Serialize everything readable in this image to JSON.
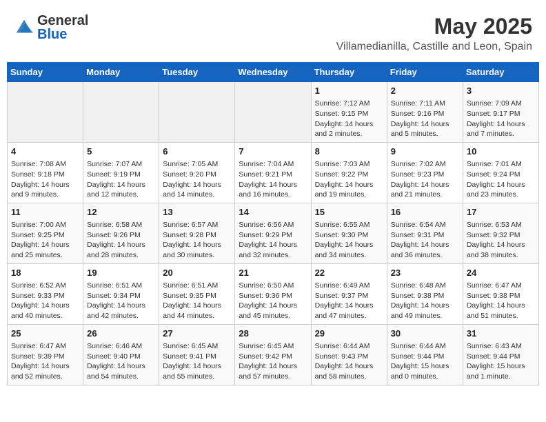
{
  "header": {
    "logo_general": "General",
    "logo_blue": "Blue",
    "month": "May 2025",
    "location": "Villamedianilla, Castille and Leon, Spain"
  },
  "days_of_week": [
    "Sunday",
    "Monday",
    "Tuesday",
    "Wednesday",
    "Thursday",
    "Friday",
    "Saturday"
  ],
  "weeks": [
    [
      {
        "day": "",
        "info": ""
      },
      {
        "day": "",
        "info": ""
      },
      {
        "day": "",
        "info": ""
      },
      {
        "day": "",
        "info": ""
      },
      {
        "day": "1",
        "info": "Sunrise: 7:12 AM\nSunset: 9:15 PM\nDaylight: 14 hours\nand 2 minutes."
      },
      {
        "day": "2",
        "info": "Sunrise: 7:11 AM\nSunset: 9:16 PM\nDaylight: 14 hours\nand 5 minutes."
      },
      {
        "day": "3",
        "info": "Sunrise: 7:09 AM\nSunset: 9:17 PM\nDaylight: 14 hours\nand 7 minutes."
      }
    ],
    [
      {
        "day": "4",
        "info": "Sunrise: 7:08 AM\nSunset: 9:18 PM\nDaylight: 14 hours\nand 9 minutes."
      },
      {
        "day": "5",
        "info": "Sunrise: 7:07 AM\nSunset: 9:19 PM\nDaylight: 14 hours\nand 12 minutes."
      },
      {
        "day": "6",
        "info": "Sunrise: 7:05 AM\nSunset: 9:20 PM\nDaylight: 14 hours\nand 14 minutes."
      },
      {
        "day": "7",
        "info": "Sunrise: 7:04 AM\nSunset: 9:21 PM\nDaylight: 14 hours\nand 16 minutes."
      },
      {
        "day": "8",
        "info": "Sunrise: 7:03 AM\nSunset: 9:22 PM\nDaylight: 14 hours\nand 19 minutes."
      },
      {
        "day": "9",
        "info": "Sunrise: 7:02 AM\nSunset: 9:23 PM\nDaylight: 14 hours\nand 21 minutes."
      },
      {
        "day": "10",
        "info": "Sunrise: 7:01 AM\nSunset: 9:24 PM\nDaylight: 14 hours\nand 23 minutes."
      }
    ],
    [
      {
        "day": "11",
        "info": "Sunrise: 7:00 AM\nSunset: 9:25 PM\nDaylight: 14 hours\nand 25 minutes."
      },
      {
        "day": "12",
        "info": "Sunrise: 6:58 AM\nSunset: 9:26 PM\nDaylight: 14 hours\nand 28 minutes."
      },
      {
        "day": "13",
        "info": "Sunrise: 6:57 AM\nSunset: 9:28 PM\nDaylight: 14 hours\nand 30 minutes."
      },
      {
        "day": "14",
        "info": "Sunrise: 6:56 AM\nSunset: 9:29 PM\nDaylight: 14 hours\nand 32 minutes."
      },
      {
        "day": "15",
        "info": "Sunrise: 6:55 AM\nSunset: 9:30 PM\nDaylight: 14 hours\nand 34 minutes."
      },
      {
        "day": "16",
        "info": "Sunrise: 6:54 AM\nSunset: 9:31 PM\nDaylight: 14 hours\nand 36 minutes."
      },
      {
        "day": "17",
        "info": "Sunrise: 6:53 AM\nSunset: 9:32 PM\nDaylight: 14 hours\nand 38 minutes."
      }
    ],
    [
      {
        "day": "18",
        "info": "Sunrise: 6:52 AM\nSunset: 9:33 PM\nDaylight: 14 hours\nand 40 minutes."
      },
      {
        "day": "19",
        "info": "Sunrise: 6:51 AM\nSunset: 9:34 PM\nDaylight: 14 hours\nand 42 minutes."
      },
      {
        "day": "20",
        "info": "Sunrise: 6:51 AM\nSunset: 9:35 PM\nDaylight: 14 hours\nand 44 minutes."
      },
      {
        "day": "21",
        "info": "Sunrise: 6:50 AM\nSunset: 9:36 PM\nDaylight: 14 hours\nand 45 minutes."
      },
      {
        "day": "22",
        "info": "Sunrise: 6:49 AM\nSunset: 9:37 PM\nDaylight: 14 hours\nand 47 minutes."
      },
      {
        "day": "23",
        "info": "Sunrise: 6:48 AM\nSunset: 9:38 PM\nDaylight: 14 hours\nand 49 minutes."
      },
      {
        "day": "24",
        "info": "Sunrise: 6:47 AM\nSunset: 9:38 PM\nDaylight: 14 hours\nand 51 minutes."
      }
    ],
    [
      {
        "day": "25",
        "info": "Sunrise: 6:47 AM\nSunset: 9:39 PM\nDaylight: 14 hours\nand 52 minutes."
      },
      {
        "day": "26",
        "info": "Sunrise: 6:46 AM\nSunset: 9:40 PM\nDaylight: 14 hours\nand 54 minutes."
      },
      {
        "day": "27",
        "info": "Sunrise: 6:45 AM\nSunset: 9:41 PM\nDaylight: 14 hours\nand 55 minutes."
      },
      {
        "day": "28",
        "info": "Sunrise: 6:45 AM\nSunset: 9:42 PM\nDaylight: 14 hours\nand 57 minutes."
      },
      {
        "day": "29",
        "info": "Sunrise: 6:44 AM\nSunset: 9:43 PM\nDaylight: 14 hours\nand 58 minutes."
      },
      {
        "day": "30",
        "info": "Sunrise: 6:44 AM\nSunset: 9:44 PM\nDaylight: 15 hours\nand 0 minutes."
      },
      {
        "day": "31",
        "info": "Sunrise: 6:43 AM\nSunset: 9:44 PM\nDaylight: 15 hours\nand 1 minute."
      }
    ]
  ]
}
